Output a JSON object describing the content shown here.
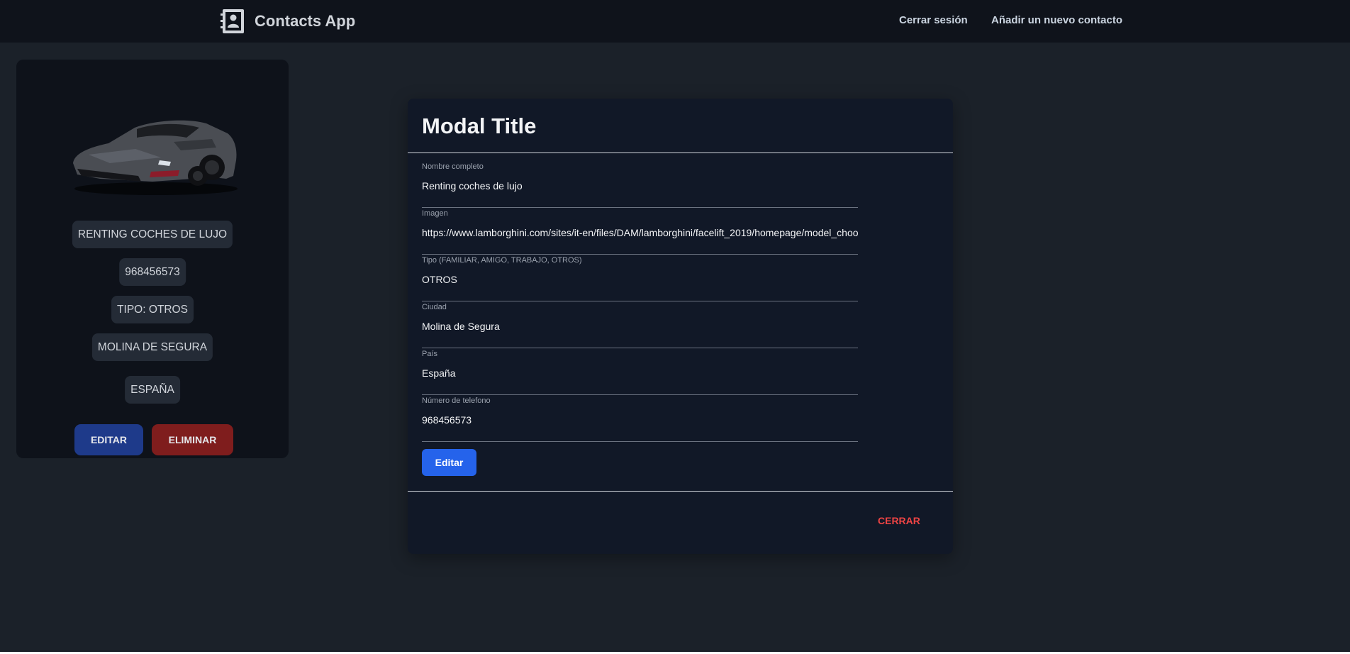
{
  "navbar": {
    "brand_icon": "contact-book-icon",
    "brand_name": "Contacts App",
    "logout_label": "Cerrar sesión",
    "add_contact_label": "Añadir un nuevo contacto"
  },
  "contact_card": {
    "image": "sports-car-image",
    "name": "RENTING COCHES DE LUJO",
    "phone": "968456573",
    "type": "TIPO: OTROS",
    "city": "MOLINA DE SEGURA",
    "country": "ESPAÑA",
    "edit_label": "EDITAR",
    "delete_label": "ELIMINAR"
  },
  "modal": {
    "title": "Modal Title",
    "fields": [
      {
        "label": "Nombre completo",
        "value": "Renting coches de lujo"
      },
      {
        "label": "Imagen",
        "value": "https://www.lamborghini.com/sites/it-en/files/DAM/lamborghini/facelift_2019/homepage/model_chooser/aventador_s.png"
      },
      {
        "label": "Tipo (FAMILIAR, AMIGO, TRABAJO, OTROS)",
        "value": "OTROS"
      },
      {
        "label": "Ciudad",
        "value": "Molina de Segura"
      },
      {
        "label": "País",
        "value": "España"
      },
      {
        "label": "Número de telefono",
        "value": "968456573"
      }
    ],
    "submit_label": "Editar",
    "close_label": "CERRAR"
  },
  "colors": {
    "page_bg": "#1b2129",
    "navbar_bg": "#0f131b",
    "card_bg": "#0e121a",
    "modal_bg": "#111827",
    "primary": "#2563eb",
    "danger": "#ef4444"
  }
}
